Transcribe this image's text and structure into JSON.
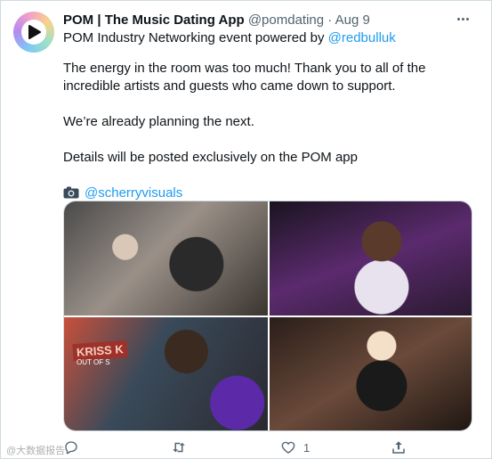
{
  "tweet": {
    "display_name": "POM | The Music Dating App",
    "handle": "@pomdating",
    "separator": "·",
    "date": "Aug 9",
    "subline_prefix": "POM Industry Networking event powered by ",
    "subline_mention": "@redbulluk",
    "paragraphs": [
      "The energy in the room was too much! Thank you to all of the incredible artists and guests who came down to support.",
      "We’re already planning the next.",
      "Details will be posted exclusively on the POM app"
    ],
    "credit_mention": "@scherryvisuals",
    "photo_sign_text": "KRISS K",
    "photo_sign_sub": "OUT OF S"
  },
  "actions": {
    "like_count": "1"
  },
  "icons": {
    "avatar": "pom-play-logo",
    "more": "more-dots-icon",
    "camera": "camera-icon",
    "reply": "reply-icon",
    "retweet": "retweet-icon",
    "like": "heart-icon",
    "share": "share-icon"
  },
  "watermark": "@大数据报告",
  "colors": {
    "link": "#1d9bf0",
    "secondary": "#536471",
    "text": "#0f1419"
  }
}
